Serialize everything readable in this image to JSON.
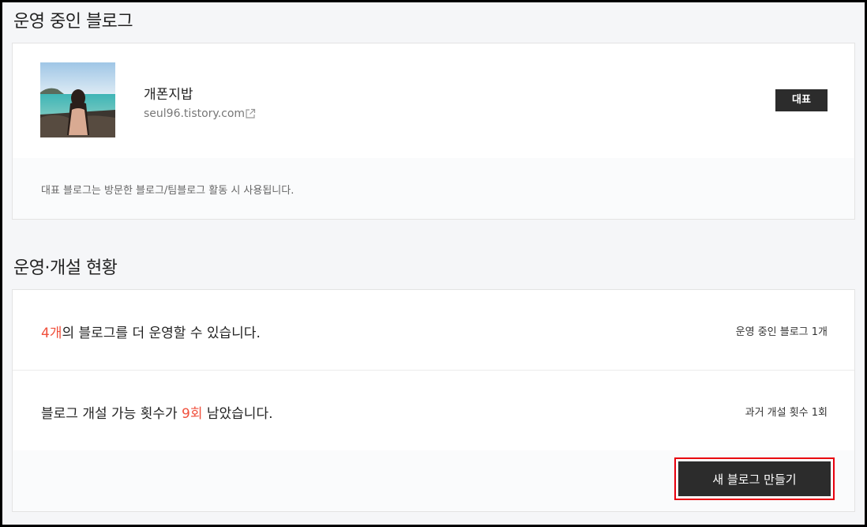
{
  "sections": {
    "operating_title": "운영 중인 블로그",
    "status_title": "운영·개설 현황"
  },
  "blog": {
    "name": "개폰지밥",
    "url": "seul96.tistory.com",
    "badge": "대표",
    "note": "대표 블로그는 방문한 블로그/팀블로그 활동 시 사용됩니다."
  },
  "status": {
    "row1": {
      "highlight": "4개",
      "text": "의 블로그를 더 운영할 수 있습니다.",
      "side": "운영 중인 블로그 1개"
    },
    "row2": {
      "prefix": "블로그 개설 가능 횟수가 ",
      "highlight": "9회",
      "suffix": " 남았습니다.",
      "side": "과거 개설 횟수 1회"
    }
  },
  "actions": {
    "new_blog": "새 블로그 만들기"
  },
  "colors": {
    "highlight": "#f0503c",
    "button_bg": "#2c2c2c",
    "focus_outline": "#e8000e"
  },
  "icons": {
    "external_link": "external-link-icon"
  }
}
